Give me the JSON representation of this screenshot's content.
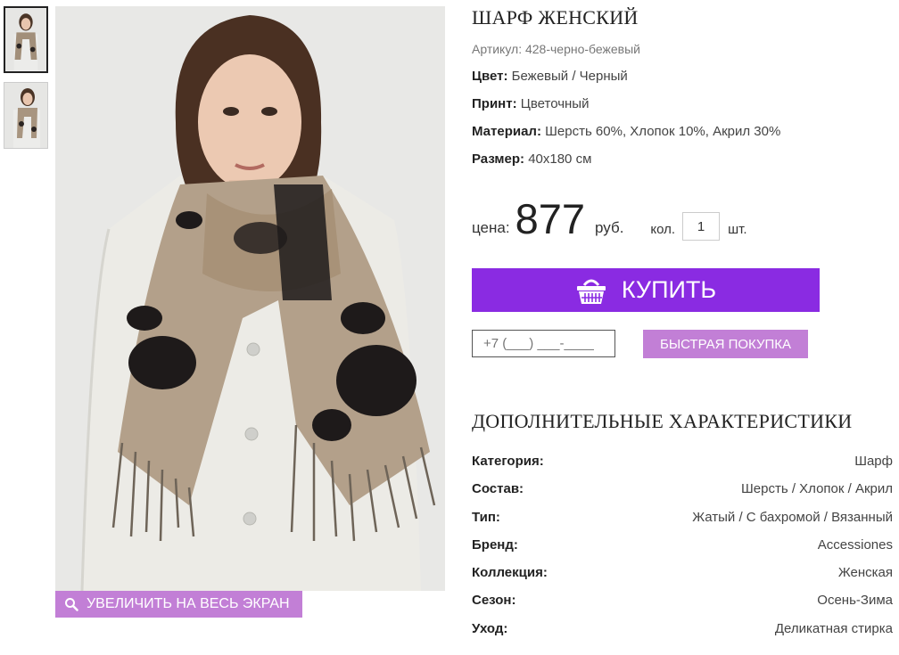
{
  "product": {
    "title": "ШАРФ ЖЕНСКИЙ",
    "sku": "Артикул: 428-черно-бежевый",
    "props": [
      {
        "label": "Цвет:",
        "value": "Бежевый / Черный"
      },
      {
        "label": "Принт:",
        "value": "Цветочный"
      },
      {
        "label": "Материал:",
        "value": "Шерсть 60%, Хлопок 10%, Акрил 30%"
      },
      {
        "label": "Размер:",
        "value": "40x180 см"
      }
    ]
  },
  "price": {
    "label": "цена:",
    "value": "877",
    "currency": "руб.",
    "qty_label": "кол.",
    "qty_value": "1",
    "qty_unit": "шт."
  },
  "actions": {
    "buy_label": "КУПИТЬ",
    "phone_placeholder": "+7 (___) ___-____",
    "quick_buy_label": "БЫСТРАЯ ПОКУПКА",
    "zoom_label": "УВЕЛИЧИТЬ НА ВЕСЬ ЭКРАН"
  },
  "specs": {
    "title": "ДОПОЛНИТЕЛЬНЫЕ ХАРАКТЕРИСТИКИ",
    "rows": [
      {
        "key": "Категория:",
        "value": "Шарф"
      },
      {
        "key": "Состав:",
        "value": "Шерсть / Хлопок / Акрил"
      },
      {
        "key": "Тип:",
        "value": "Жатый / С бахромой / Вязанный"
      },
      {
        "key": "Бренд:",
        "value": "Accessiones"
      },
      {
        "key": "Коллекция:",
        "value": "Женская"
      },
      {
        "key": "Сезон:",
        "value": "Осень-Зима"
      },
      {
        "key": "Уход:",
        "value": "Деликатная стирка"
      }
    ]
  },
  "icons": {
    "zoom": "search-icon",
    "buy": "basket-icon"
  },
  "colors": {
    "accent": "#8a2be2",
    "accent_light": "#c27fd6"
  }
}
